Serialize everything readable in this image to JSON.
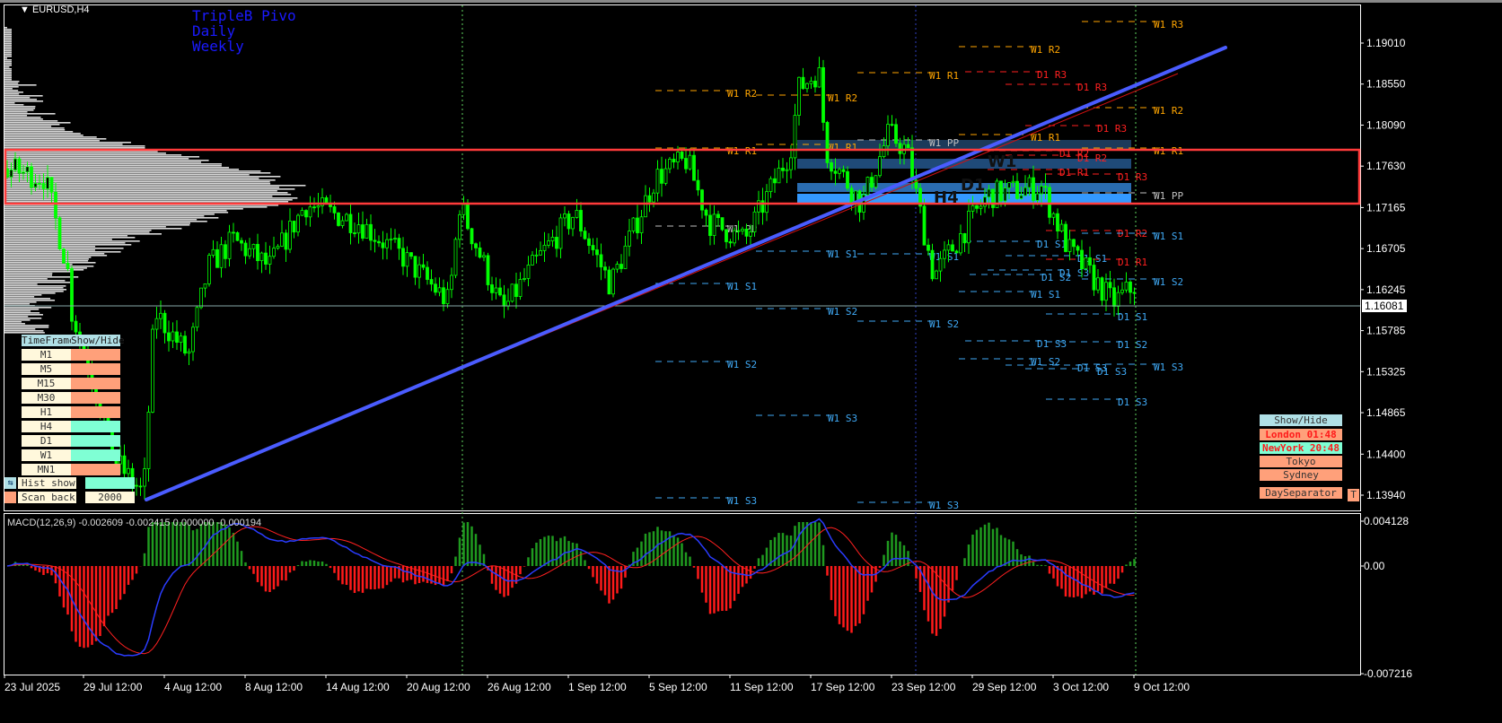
{
  "chart": {
    "symbol": "EURUSD,H4",
    "indicator_title": [
      "TripleB Pivo",
      "Daily",
      "Weekly"
    ],
    "current_price": "1.16081",
    "price_ticks": [
      "1.19010",
      "1.18550",
      "1.18090",
      "1.17630",
      "1.17165",
      "1.16705",
      "1.16245",
      "1.15785",
      "1.15325",
      "1.14865",
      "1.14400",
      "1.13940"
    ],
    "time_ticks": [
      "23 Jul 2025",
      "29 Jul 12:00",
      "4 Aug 12:00",
      "8 Aug 12:00",
      "14 Aug 12:00",
      "20 Aug 12:00",
      "26 Aug 12:00",
      "1 Sep 12:00",
      "5 Sep 12:00",
      "11 Sep 12:00",
      "17 Sep 12:00",
      "23 Sep 12:00",
      "29 Sep 12:00",
      "3 Oct 12:00",
      "9 Oct 12:00"
    ],
    "zone_labels": [
      "W1",
      "D1",
      "H4"
    ],
    "pivot_labels": [
      "W1 R3",
      "W1 R2",
      "W1 R1",
      "W1 R2",
      "W1 R2",
      "W1 R2",
      "W1 R1",
      "W1 R1",
      "W1 R1",
      "W1 R1",
      "D1 R3",
      "D1 R3",
      "D1 R3",
      "D1 R2",
      "D1 R2",
      "D1 R3",
      "D1 R1",
      "D1 R2",
      "D1 R1",
      "W1 PP",
      "W1 PP",
      "W1 PP",
      "W1 S1",
      "W1 S1",
      "W1 S1",
      "W1 S1",
      "W1 S1",
      "W1 S2",
      "W1 S2",
      "W1 S2",
      "W1 S2",
      "W1 S2",
      "W1 S3",
      "W1 S3",
      "W1 S3",
      "W1 S3",
      "D1 S1",
      "D1 S1",
      "D1 S2",
      "D1 S3",
      "D1 S3",
      "D1 S1",
      "D1 S2",
      "D1 S3",
      "D1 S3",
      "D1 S3"
    ],
    "colors": {
      "weekly": "#ffa500",
      "daily_r": "#ff2020",
      "pp": "#c0c0c0",
      "support": "#3fa9f5",
      "candle": "#00ff00",
      "trend": "#4a5cff",
      "box": "#ff3b3b"
    }
  },
  "macd": {
    "label": "MACD(12,26,9) -0.002609 -0.002415 0.000000 -0.000194",
    "ticks": [
      "0.004128",
      "0.00",
      "-0.007216"
    ]
  },
  "timeframe_panel": {
    "header": [
      "TimeFrame",
      "Show/Hide"
    ],
    "rows": [
      {
        "name": "M1",
        "on": false
      },
      {
        "name": "M5",
        "on": false
      },
      {
        "name": "M15",
        "on": false
      },
      {
        "name": "M30",
        "on": false
      },
      {
        "name": "H1",
        "on": false
      },
      {
        "name": "H4",
        "on": true
      },
      {
        "name": "D1",
        "on": true
      },
      {
        "name": "W1",
        "on": true
      },
      {
        "name": "MN1",
        "on": false
      }
    ],
    "hist_show": "Hist show",
    "scan_back_label": "Scan back",
    "scan_back_value": "2000"
  },
  "sessions": {
    "show_hide": "Show/Hide",
    "london": "London  01:48",
    "newyork": "NewYork  20:48",
    "tokyo": "Tokyo",
    "sydney": "Sydney",
    "day_separator": "DaySeparator",
    "t_button": "T"
  }
}
